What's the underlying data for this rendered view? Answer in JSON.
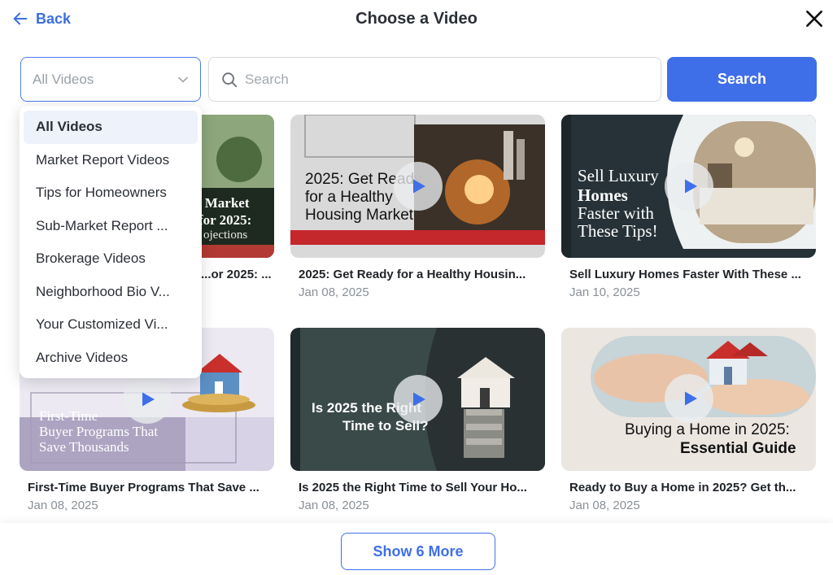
{
  "header": {
    "back_label": "Back",
    "title": "Choose a Video"
  },
  "filter": {
    "selected": "All Videos",
    "options": [
      "All Videos",
      "Market Report Videos",
      "Tips for Homeowners",
      "Sub-Market Report ...",
      "Brokerage Videos",
      "Neighborhood Bio V...",
      "Your Customized Vi...",
      "Archive Videos"
    ]
  },
  "search": {
    "placeholder": "Search",
    "value": "",
    "button_label": "Search"
  },
  "videos": [
    {
      "title": "...or 2025: ...",
      "date": "",
      "thumb_text": [
        "g Market",
        "for 2025:",
        "ojections"
      ]
    },
    {
      "title": "2025: Get Ready for a Healthy Housin...",
      "date": "Jan 08, 2025",
      "thumb_text": [
        "2025: Get Ready",
        "for a Healthy",
        "Housing Market"
      ]
    },
    {
      "title": "Sell Luxury Homes Faster With These ...",
      "date": "Jan 10, 2025",
      "thumb_text": [
        "Sell Luxury",
        "Homes",
        "Faster with",
        "These Tips!"
      ]
    },
    {
      "title": "First-Time Buyer Programs That Save ...",
      "date": "Jan 08, 2025",
      "thumb_text": [
        "First-Time",
        "Buyer Programs That",
        "Save Thousands"
      ]
    },
    {
      "title": "Is 2025 the Right Time to Sell Your Ho...",
      "date": "Jan 08, 2025",
      "thumb_text": [
        "Is 2025 the Right",
        "Time to Sell?"
      ]
    },
    {
      "title": "Ready to Buy a Home in 2025? Get th...",
      "date": "Jan 08, 2025",
      "thumb_text": [
        "Buying a Home in 2025:",
        "Essential Guide"
      ]
    }
  ],
  "footer": {
    "more_label": "Show 6 More"
  },
  "colors": {
    "accent": "#3f6fe8",
    "play_icon": "#3f6fe8"
  }
}
